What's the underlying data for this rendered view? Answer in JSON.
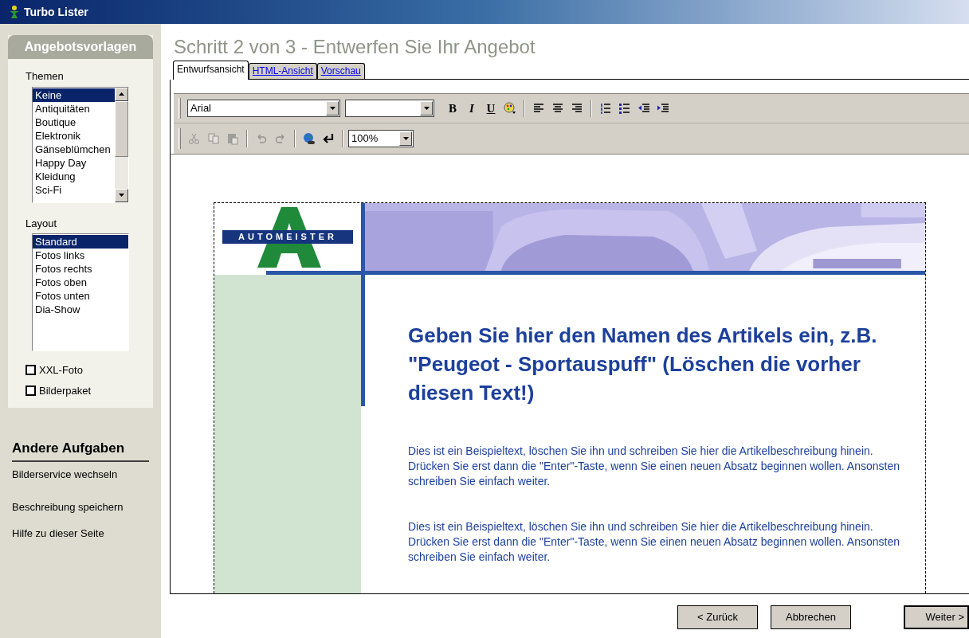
{
  "window": {
    "title": "Turbo Lister"
  },
  "sidebar": {
    "heading": "Angebotsvorlagen",
    "themes": {
      "label": "Themen",
      "items": [
        {
          "label": "Keine",
          "selected": true
        },
        {
          "label": "Antiquitäten",
          "selected": false
        },
        {
          "label": "Boutique",
          "selected": false
        },
        {
          "label": "Elektronik",
          "selected": false
        },
        {
          "label": "Gänseblümchen",
          "selected": false
        },
        {
          "label": "Happy Day",
          "selected": false
        },
        {
          "label": "Kleidung",
          "selected": false
        },
        {
          "label": "Sci-Fi",
          "selected": false
        }
      ]
    },
    "layout": {
      "label": "Layout",
      "items": [
        {
          "label": "Standard",
          "selected": true
        },
        {
          "label": "Fotos links",
          "selected": false
        },
        {
          "label": "Fotos rechts",
          "selected": false
        },
        {
          "label": "Fotos oben",
          "selected": false
        },
        {
          "label": "Fotos unten",
          "selected": false
        },
        {
          "label": "Dia-Show",
          "selected": false
        }
      ]
    },
    "options": [
      {
        "label": "XXL-Foto",
        "checked": false
      },
      {
        "label": "Bilderpaket",
        "checked": false
      }
    ],
    "other_tasks": {
      "heading": "Andere Aufgaben",
      "links": [
        "Bilderservice wechseln",
        "Beschreibung speichern",
        "Hilfe zu dieser Seite"
      ]
    }
  },
  "page_title": "Schritt 2 von 3 - Entwerfen Sie Ihr Angebot",
  "tabs": [
    {
      "label": "Entwurfsansicht",
      "selected": true
    },
    {
      "label": "HTML-Ansicht",
      "selected": false
    },
    {
      "label": "Vorschau",
      "selected": false
    }
  ],
  "toolbar": {
    "font": "Arial",
    "format_buttons": [
      "B",
      "I",
      "U"
    ],
    "zoom": "100%",
    "edit_disabled": true
  },
  "document": {
    "logo_text": "AUTOMEISTER",
    "heading": "Geben Sie hier den Namen des Artikels ein, z.B. \"Peugeot - Sportauspuff\" (Löschen die vorher diesen Text!)",
    "paragraphs": [
      "Dies ist ein Beispieltext, löschen Sie ihn und schreiben Sie hier die Artikelbeschreibung hinein. Drücken Sie erst dann die \"Enter\"-Taste, wenn Sie einen neuen Absatz beginnen wollen. Ansonsten schreiben Sie einfach weiter.",
      "Dies ist ein Beispieltext, löschen Sie ihn und schreiben Sie hier die Artikelbeschreibung hinein. Drücken Sie erst dann die \"Enter\"-Taste, wenn Sie einen neuen Absatz beginnen wollen. Ansonsten schreiben Sie einfach weiter."
    ]
  },
  "buttons": [
    "< Zurück",
    "Abbrechen",
    "Weiter >"
  ]
}
